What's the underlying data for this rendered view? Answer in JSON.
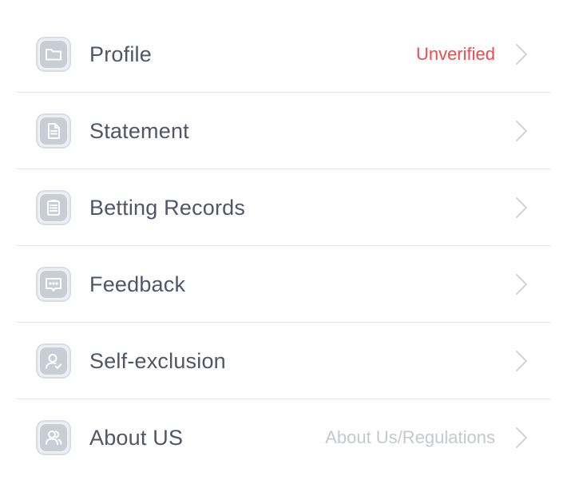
{
  "menu": {
    "items": [
      {
        "label": "Profile",
        "status": "Unverified",
        "status_color": "#ef4a4d",
        "icon": "folder-icon"
      },
      {
        "label": "Statement",
        "status": "",
        "icon": "document-icon"
      },
      {
        "label": "Betting Records",
        "status": "",
        "icon": "clipboard-icon"
      },
      {
        "label": "Feedback",
        "status": "",
        "icon": "message-bubble-icon"
      },
      {
        "label": "Self-exclusion",
        "status": "",
        "icon": "user-check-icon"
      },
      {
        "label": "About US",
        "status": "About Us/Regulations",
        "status_color": "#c5c8d0",
        "icon": "users-icon"
      }
    ]
  },
  "colors": {
    "label": "#50556a",
    "divider": "#e8e9ed",
    "icon_fill": "#c9cdd5",
    "chevron": "#d0d3d9"
  }
}
